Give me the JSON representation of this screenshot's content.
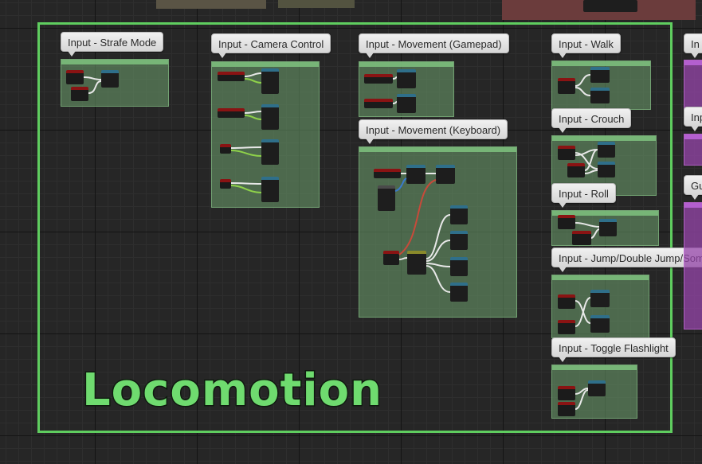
{
  "canvas": {
    "frame_title": "Locomotion",
    "comments": [
      {
        "id": "strafe",
        "bubble": "Input - Strafe Mode"
      },
      {
        "id": "camera",
        "bubble": "Input - Camera Control"
      },
      {
        "id": "gamepad",
        "bubble": "Input - Movement (Gamepad)"
      },
      {
        "id": "keyboard",
        "bubble": "Input - Movement (Keyboard)"
      },
      {
        "id": "walk",
        "bubble": "Input - Walk"
      },
      {
        "id": "crouch",
        "bubble": "Input - Crouch"
      },
      {
        "id": "roll",
        "bubble": "Input - Roll"
      },
      {
        "id": "jump",
        "bubble": "Input - Jump/Double Jump/Som"
      },
      {
        "id": "flashlight",
        "bubble": "Input - Toggle Flashlight"
      }
    ],
    "right_partial": [
      {
        "bubble": "In"
      },
      {
        "bubble": "Inp"
      },
      {
        "bubble": "Gu"
      }
    ]
  },
  "colors": {
    "frame": "#5fcd5f",
    "wire_white": "#e8e8e8",
    "wire_green": "#8fd24a",
    "wire_red": "#c84a3a",
    "wire_blue": "#3a7acc"
  }
}
